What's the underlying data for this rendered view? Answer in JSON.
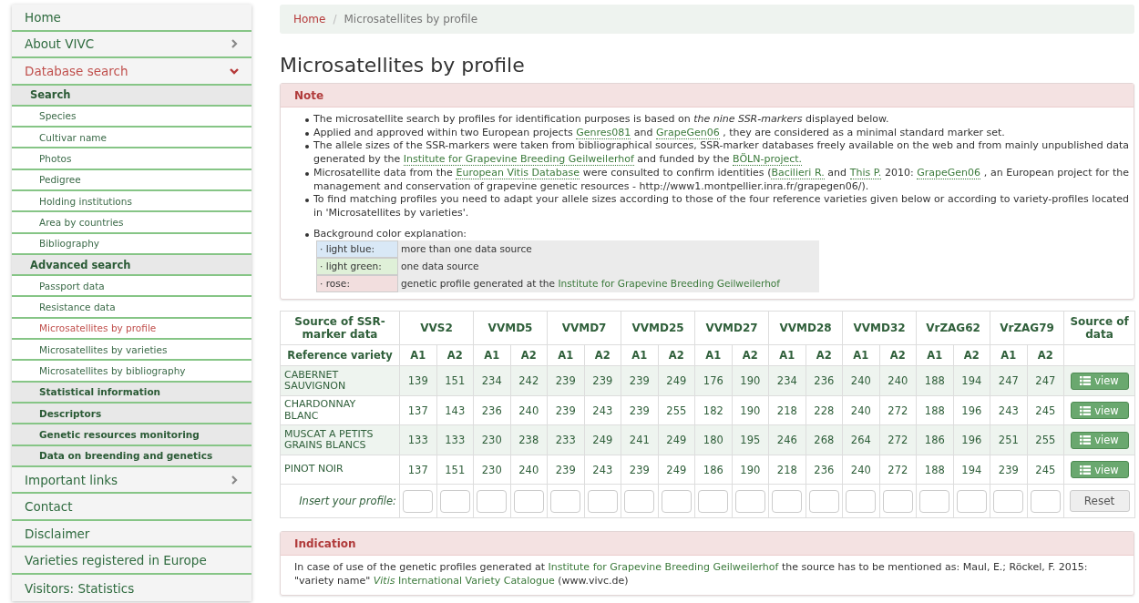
{
  "sidebar": {
    "items": [
      {
        "label": "Home",
        "kind": "main",
        "selected": false
      },
      {
        "label": "About VIVC",
        "kind": "main",
        "selected": false,
        "expanded": false
      },
      {
        "label": "Database search",
        "kind": "main",
        "selected": true,
        "expanded": true
      },
      {
        "label": "Search",
        "kind": "group",
        "selected": false
      },
      {
        "label": "Species",
        "kind": "sub",
        "selected": false
      },
      {
        "label": "Cultivar name",
        "kind": "sub",
        "selected": false
      },
      {
        "label": "Photos",
        "kind": "sub",
        "selected": false
      },
      {
        "label": "Pedigree",
        "kind": "sub",
        "selected": false
      },
      {
        "label": "Holding institutions",
        "kind": "sub",
        "selected": false
      },
      {
        "label": "Area by countries",
        "kind": "sub",
        "selected": false
      },
      {
        "label": "Bibliography",
        "kind": "sub",
        "selected": false
      },
      {
        "label": "Advanced search",
        "kind": "group",
        "selected": false
      },
      {
        "label": "Passport data",
        "kind": "sub",
        "selected": false
      },
      {
        "label": "Resistance data",
        "kind": "sub",
        "selected": false
      },
      {
        "label": "Microsatellites by profile",
        "kind": "sub",
        "selected": true
      },
      {
        "label": "Microsatellites by varieties",
        "kind": "sub",
        "selected": false
      },
      {
        "label": "Microsatellites by bibliography",
        "kind": "sub",
        "selected": false
      },
      {
        "label": "Statistical information",
        "kind": "subgroup",
        "selected": false
      },
      {
        "label": "Descriptors",
        "kind": "subgroup",
        "selected": false
      },
      {
        "label": "Genetic resources monitoring",
        "kind": "subgroup",
        "selected": false
      },
      {
        "label": "Data on breending and genetics",
        "kind": "subgroup",
        "selected": false
      },
      {
        "label": "Important links",
        "kind": "main",
        "selected": false,
        "expanded": false
      },
      {
        "label": "Contact",
        "kind": "main",
        "selected": false
      },
      {
        "label": "Disclaimer",
        "kind": "main",
        "selected": false
      },
      {
        "label": "Varieties registered in Europe",
        "kind": "main",
        "selected": false
      },
      {
        "label": "Visitors: Statistics",
        "kind": "main",
        "selected": false
      }
    ]
  },
  "breadcrumb": {
    "home": "Home",
    "separator": "/",
    "current": "Microsatellites by profile"
  },
  "title": "Microsatellites by profile",
  "note": {
    "heading": "Note",
    "bullets": [
      {
        "parts": [
          {
            "kind": "text",
            "text": "The microsatellite search by profiles for identification purposes is based on *the nine SSR-markers* displayed below."
          }
        ]
      },
      {
        "parts": [
          {
            "kind": "text",
            "text": "Applied and approved within two European projects "
          },
          {
            "kind": "link",
            "text": "Genres081"
          },
          {
            "kind": "text",
            "text": " and "
          },
          {
            "kind": "link",
            "text": "GrapeGen06"
          },
          {
            "kind": "text",
            "text": " , they are considered as a minimal standard marker set."
          }
        ]
      },
      {
        "parts": [
          {
            "kind": "text",
            "text": "The allele sizes of the SSR-markers were taken from bibliographical sources, SSR-marker databases freely available on the web and from mainly unpublished data generated by the "
          },
          {
            "kind": "link",
            "text": "Institute for Grapevine Breeding Geilweilerhof"
          },
          {
            "kind": "text",
            "text": " and funded by the "
          },
          {
            "kind": "link",
            "text": "BÖLN-project."
          }
        ]
      },
      {
        "parts": [
          {
            "kind": "text",
            "text": "Microsatellite data from the "
          },
          {
            "kind": "link",
            "text": "European Vitis Database"
          },
          {
            "kind": "text",
            "text": " were consulted to confirm identities ("
          },
          {
            "kind": "link",
            "text": "Bacilieri R."
          },
          {
            "kind": "text",
            "text": " and "
          },
          {
            "kind": "link",
            "text": "This P."
          },
          {
            "kind": "text",
            "text": " 2010: "
          },
          {
            "kind": "link",
            "text": "GrapeGen06"
          },
          {
            "kind": "text",
            "text": " , an European project for the management and conservation of grapevine genetic resources - http://www1.montpellier.inra.fr/grapegen06/)."
          }
        ]
      },
      {
        "parts": [
          {
            "kind": "text",
            "text": "To find matching profiles you need to adapt your allele sizes according to those of the four reference varieties given below or according to variety-profiles located in 'Microsatellites by varieties'."
          }
        ]
      }
    ],
    "legend_intro": "Background color explanation:",
    "legend": [
      {
        "key": "· light blue:",
        "color": "#d9e8f6",
        "parts": [
          {
            "kind": "text",
            "text": "more than one data source"
          }
        ]
      },
      {
        "key": "· light green:",
        "color": "#dff0d8",
        "parts": [
          {
            "kind": "text",
            "text": "one data source"
          }
        ]
      },
      {
        "key": "· rose:",
        "color": "#f2dede",
        "parts": [
          {
            "kind": "text",
            "text": "genetic profile generated at the "
          },
          {
            "kind": "link",
            "text": "Institute for Grapevine Breeding Geilweilerhof"
          }
        ]
      }
    ]
  },
  "table": {
    "source_header": "Source of SSR-marker data",
    "reference_header": "Reference variety",
    "data_header": "Source of data",
    "markers": [
      {
        "name": "VVS2",
        "alleles": [
          "A1",
          "A2"
        ]
      },
      {
        "name": "VVMD5",
        "alleles": [
          "A1",
          "A2"
        ]
      },
      {
        "name": "VVMD7",
        "alleles": [
          "A1",
          "A2"
        ]
      },
      {
        "name": "VVMD25",
        "alleles": [
          "A1",
          "A2"
        ]
      },
      {
        "name": "VVMD27",
        "alleles": [
          "A1",
          "A2"
        ]
      },
      {
        "name": "VVMD28",
        "alleles": [
          "A1",
          "A2"
        ]
      },
      {
        "name": "VVMD32",
        "alleles": [
          "A1",
          "A2"
        ]
      },
      {
        "name": "VrZAG62",
        "alleles": [
          "A1",
          "A2"
        ]
      },
      {
        "name": "VrZAG79",
        "alleles": [
          "A1",
          "A2"
        ]
      }
    ],
    "rows": [
      {
        "variety": "CABERNET SAUVIGNON",
        "values": [
          "139",
          "151",
          "234",
          "242",
          "239",
          "239",
          "239",
          "249",
          "176",
          "190",
          "234",
          "236",
          "240",
          "240",
          "188",
          "194",
          "247",
          "247"
        ],
        "button": "view"
      },
      {
        "variety": "CHARDONNAY BLANC",
        "values": [
          "137",
          "143",
          "236",
          "240",
          "239",
          "243",
          "239",
          "255",
          "182",
          "190",
          "218",
          "228",
          "240",
          "272",
          "188",
          "196",
          "243",
          "245"
        ],
        "button": "view"
      },
      {
        "variety": "MUSCAT A PETITS GRAINS BLANCS",
        "values": [
          "133",
          "133",
          "230",
          "238",
          "233",
          "249",
          "241",
          "249",
          "180",
          "195",
          "246",
          "268",
          "264",
          "272",
          "186",
          "196",
          "251",
          "255"
        ],
        "button": "view"
      },
      {
        "variety": "PINOT NOIR",
        "values": [
          "137",
          "151",
          "230",
          "240",
          "239",
          "243",
          "239",
          "249",
          "186",
          "190",
          "218",
          "236",
          "240",
          "272",
          "188",
          "194",
          "239",
          "245"
        ],
        "button": "view"
      }
    ],
    "input_label": "Insert your profile:",
    "reset": "Reset"
  },
  "indication": {
    "heading": "Indication",
    "parts": [
      {
        "kind": "text",
        "text": "In case of use of the genetic profiles generated at "
      },
      {
        "kind": "link",
        "text": "Institute for Grapevine Breeding Geilweilerhof"
      },
      {
        "kind": "text",
        "text": " the source has to be mentioned as: Maul, E.; Röckel, F. 2015: \"variety name\" "
      },
      {
        "kind": "link",
        "text": "*Vitis* International Variety Catalogue"
      },
      {
        "kind": "text",
        "text": " (www.vivc.de)"
      }
    ]
  }
}
